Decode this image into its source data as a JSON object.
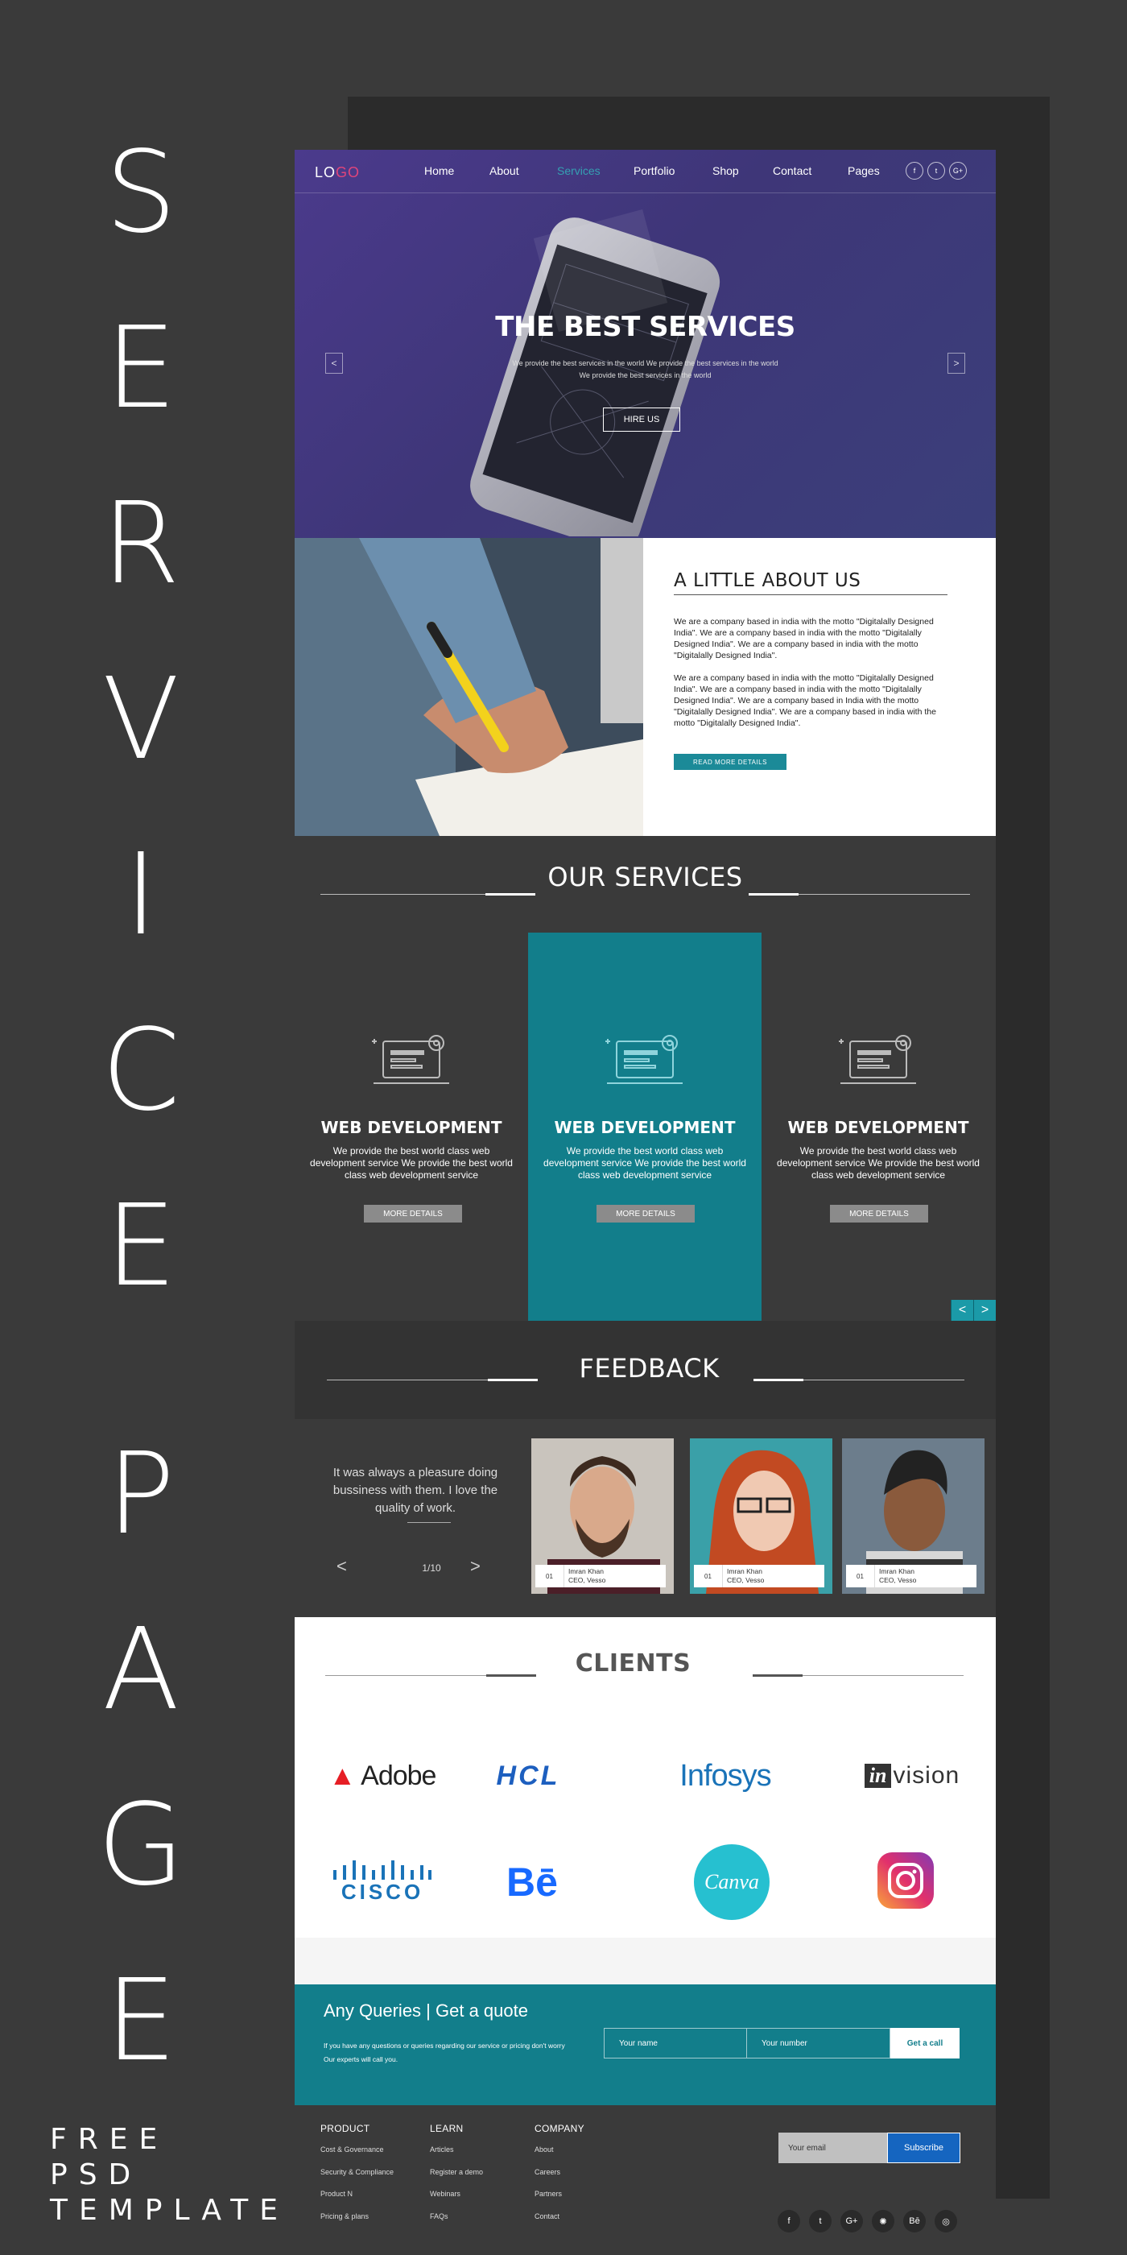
{
  "poster": {
    "title_letters": [
      "S",
      "E",
      "R",
      "V",
      "I",
      "C",
      "E",
      "P",
      "A",
      "G",
      "E"
    ],
    "subtitle_lines": [
      "FREE",
      "PSD",
      "TEMPLATE"
    ]
  },
  "nav": {
    "logo_part1": "LO",
    "logo_part2": "GO",
    "items": [
      "Home",
      "About",
      "Services",
      "Portfolio",
      "Shop",
      "Contact",
      "Pages"
    ],
    "active": "Services",
    "social": [
      "f",
      "t",
      "G+"
    ]
  },
  "hero": {
    "title": "THE BEST SERVICES",
    "sub1": "We provide the best services in the world We provide the best services in the world",
    "sub2": "We provide the best services in the world",
    "button": "HIRE US",
    "prev": "<",
    "next": ">"
  },
  "about": {
    "title": "A LITTLE ABOUT US",
    "p1": "We are  a company based in india with the motto \"Digitalally Designed India\". We are  a company based in india with the motto \"Digitalally  Designed India\". We are  a company based in india with the motto \"Digitalally  Designed India\".",
    "p2": "We are  a company based in india with the motto \"Digitalally Designed India\". We are  a company based in india with the motto \"Digitalally Designed India\".  We are  a company based in India with the motto \"Digitalally Designed India\".  We are  a company based in india with the motto \"Digitalally Designed India\".",
    "button": "READ MORE DETAILS"
  },
  "services": {
    "title": "OUR SERVICES",
    "items": [
      {
        "title": "WEB DEVELOPMENT",
        "desc": "We provide the best world class web development service We provide the best world class web development service",
        "button": "MORE DETAILS"
      },
      {
        "title": "WEB DEVELOPMENT",
        "desc": "We provide the best world class web development service We provide the best world class web development service",
        "button": "MORE DETAILS"
      },
      {
        "title": "WEB DEVELOPMENT",
        "desc": "We provide the best world class web development service We provide the best world class web development service",
        "button": "MORE DETAILS"
      }
    ],
    "prev": "<",
    "next": ">"
  },
  "feedback": {
    "title": "FEEDBACK",
    "quote": "It was always a pleasure doing bussiness with them. I love the quality of work.",
    "counter": "1/10",
    "prev": "<",
    "next": ">",
    "cards": [
      {
        "num": "01",
        "name": "Imran Khan",
        "role": "CEO, Vesso"
      },
      {
        "num": "01",
        "name": "Imran Khan",
        "role": "CEO, Vesso"
      },
      {
        "num": "01",
        "name": "Imran Khan",
        "role": "CEO, Vesso"
      }
    ]
  },
  "clients": {
    "title": "CLIENTS",
    "logos": {
      "adobe": "Adobe",
      "hcl": "HCL",
      "infosys": "Infosys",
      "invision_a": "in",
      "invision_b": "vision",
      "cisco": "CISCO",
      "behance": "Bē",
      "canva": "Canva"
    }
  },
  "quote_band": {
    "title": "Any Queries | Get a quote",
    "text1": "If you have any questions or queries regarding our service or pricing don't worry",
    "text2": "Our experts will call you.",
    "name_placeholder": "Your name",
    "number_placeholder": "Your number",
    "button": "Get a call"
  },
  "footer": {
    "columns": [
      {
        "head": "PRODUCT",
        "links": [
          "Cost & Governance",
          "Security & Compliance",
          "Product N",
          "Pricing & plans"
        ]
      },
      {
        "head": "LEARN",
        "links": [
          "Articles",
          "Register a demo",
          "Webinars",
          "FAQs"
        ]
      },
      {
        "head": "COMPANY",
        "links": [
          "About",
          "Careers",
          "Partners",
          "Contact"
        ]
      }
    ],
    "email_placeholder": "Your email",
    "subscribe": "Subscribe",
    "social": [
      "f",
      "t",
      "G+",
      "✺",
      "Bē",
      "◎"
    ]
  },
  "colors": {
    "teal": "#127e8b",
    "hero_purple": "#4b3a8c",
    "logo_pink": "#e0457b",
    "dark_bg": "#3a3a3a"
  }
}
